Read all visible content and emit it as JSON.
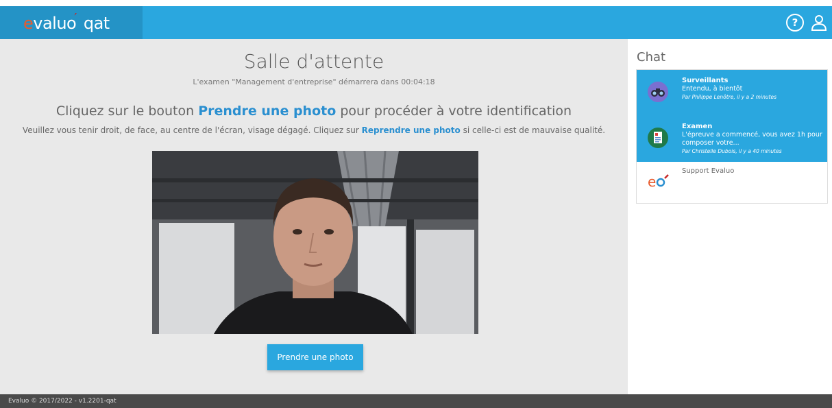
{
  "header": {
    "logo_brand_e": "e",
    "logo_brand_rest": "valuo",
    "logo_suffix": "qat",
    "help_label": "?"
  },
  "main": {
    "title": "Salle d'attente",
    "countdown_text": "L'examen \"Management d'entreprise\" démarrera dans 00:04:18",
    "instruction_before": "Cliquez sur le bouton ",
    "instruction_link": "Prendre une photo",
    "instruction_after": " pour procéder à votre identification",
    "detail_before": "Veuillez vous tenir droit, de face, au centre de l'écran, visage dégagé. Cliquez sur ",
    "detail_link": "Reprendre une photo",
    "detail_after": " si celle-ci est de mauvaise qualité.",
    "photo_button": "Prendre une photo"
  },
  "chat": {
    "title": "Chat",
    "items": [
      {
        "name": "Surveillants",
        "message": "Entendu, à bientôt",
        "meta": "Par Philippe Lenôtre, il y a 2 minutes",
        "icon": "binoculars-icon"
      },
      {
        "name": "Examen",
        "message": "L'épreuve a commencé, vous avez 1h pour composer votre...",
        "meta": "Par Christelle Dubois, il y a 40 minutes",
        "icon": "document-icon"
      },
      {
        "name": "Support Evaluo",
        "icon": "evaluo-logo-icon"
      }
    ]
  },
  "footer": {
    "text": "Evaluo © 2017/2022 - v1.2201-qat"
  },
  "colors": {
    "accent": "#2aa7df",
    "logo_box": "#2493c6",
    "link": "#2a8fd0",
    "main_bg": "#e9e9e9",
    "footer_bg": "#4a4a4a"
  }
}
